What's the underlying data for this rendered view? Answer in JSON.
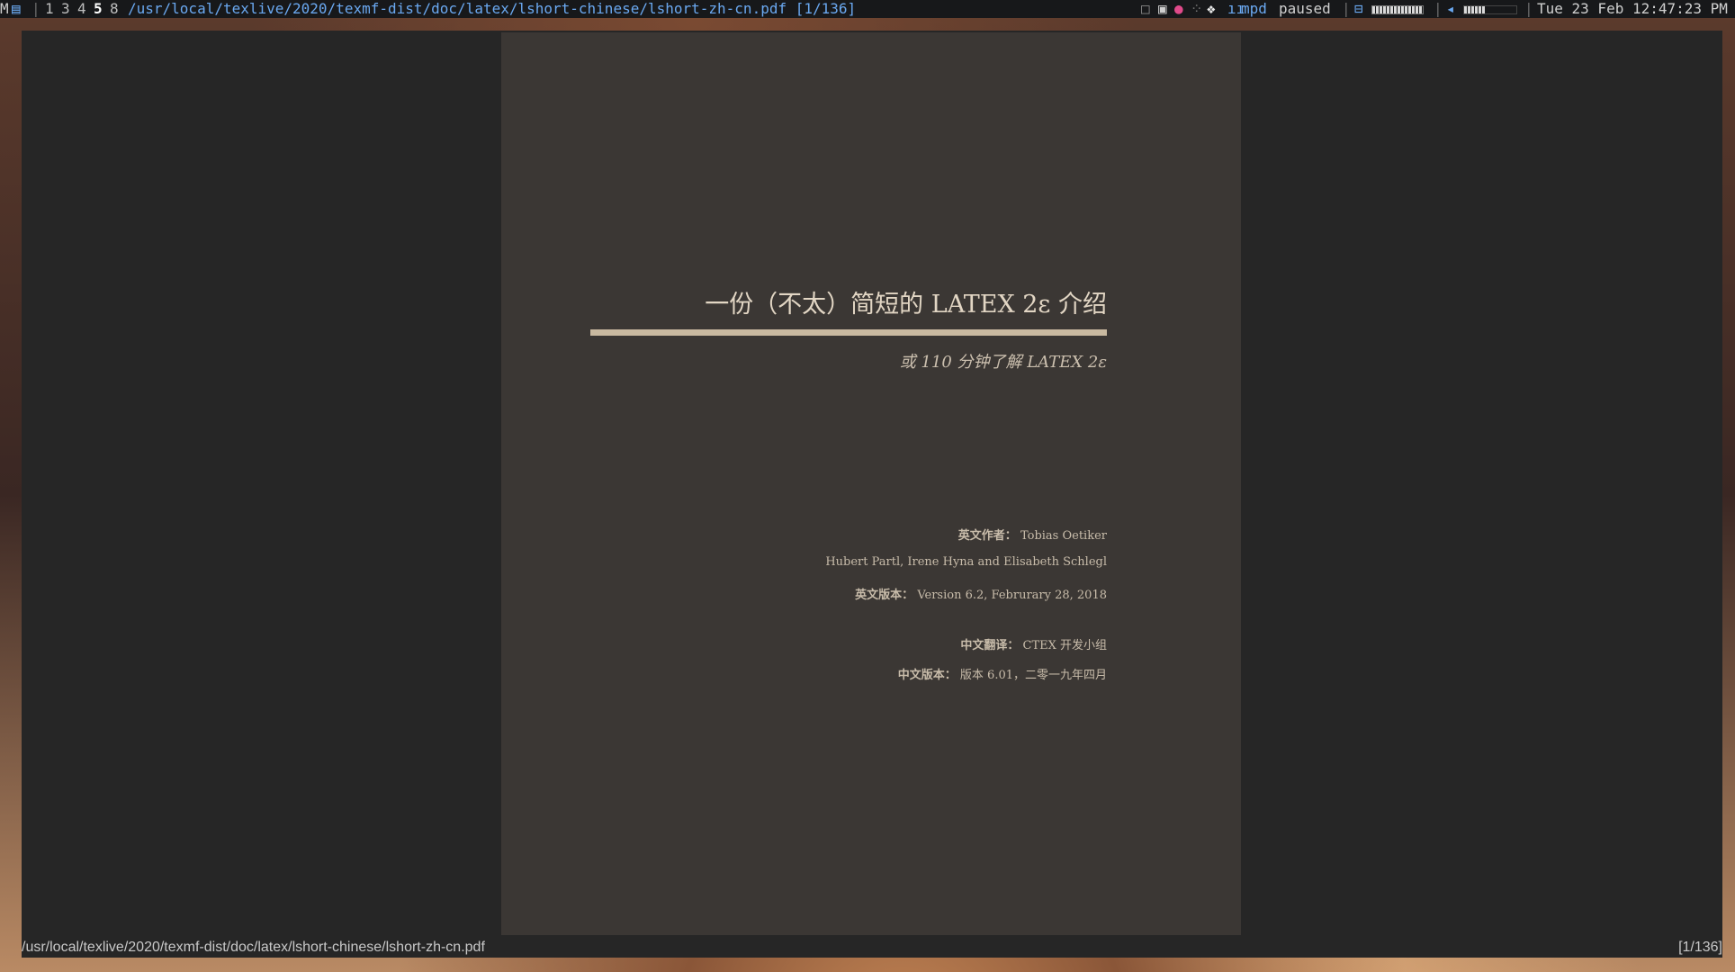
{
  "topbar": {
    "layout_indicator": "M",
    "workspaces": [
      "1",
      "3",
      "4",
      "5",
      "8"
    ],
    "active_workspace": "5",
    "window_title": "/usr/local/texlive/2020/texmf-dist/doc/latex/lshort-chinese/lshort-zh-cn.pdf [1/136]",
    "mpd_label": "mpd",
    "mpd_state": "paused",
    "battery_level": 1.0,
    "volume_level": 0.4,
    "clock": "Tue 23 Feb 12:47:23 PM",
    "colors": {
      "bar_bg": "#17181a",
      "title_color": "#6aa8f0"
    }
  },
  "document": {
    "title": "一份（不太）简短的 LATEX 2ε 介绍",
    "subtitle": "或 110 分钟了解 LATEX 2ε",
    "author_label": "英文作者：",
    "author_value": "Tobias Oetiker",
    "coauthors": "Hubert Partl, Irene Hyna and Elisabeth Schlegl",
    "version_label": "英文版本：",
    "version_value": "Version 6.2, Februrary 28, 2018",
    "translation_label": "中文翻译：",
    "translation_value": "CTEX 开发小组",
    "cn_version_label": "中文版本：",
    "cn_version_value": "版本 6.01，二零一九年四月"
  },
  "statusbar": {
    "file_path": "/usr/local/texlive/2020/texmf-dist/doc/latex/lshort-chinese/lshort-zh-cn.pdf",
    "page_indicator": "[1/136]"
  }
}
